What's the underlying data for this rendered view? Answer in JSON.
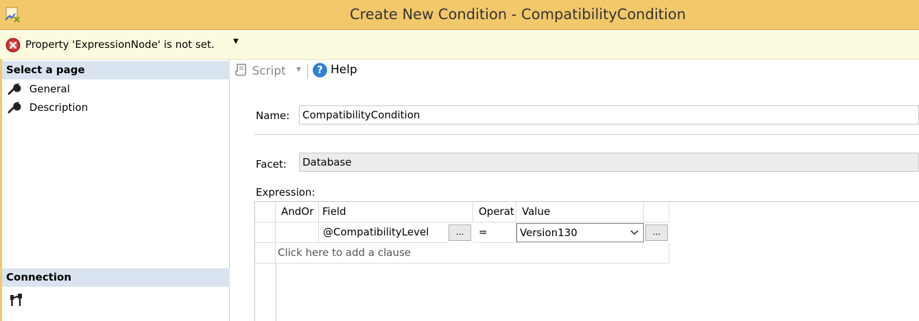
{
  "window": {
    "title": "Create New Condition - CompatibilityCondition",
    "app_icon": "policy-condition-icon"
  },
  "message_bar": {
    "icon": "error-icon",
    "text": "Property 'ExpressionNode' is not set."
  },
  "left_pane": {
    "select_page_header": "Select a page",
    "pages": [
      {
        "label": "General",
        "icon": "wrench-icon",
        "selected": true
      },
      {
        "label": "Description",
        "icon": "wrench-icon",
        "selected": false
      }
    ],
    "connection_header": "Connection",
    "connection_icon": "connection-icon"
  },
  "toolbar": {
    "script_label": "Script",
    "help_label": "Help"
  },
  "form": {
    "name_label": "Name:",
    "name_value": "CompatibilityCondition",
    "facet_label": "Facet:",
    "facet_value": "Database",
    "expression_label": "Expression:"
  },
  "expression_grid": {
    "columns": [
      "AndOr",
      "Field",
      "Operat",
      "Value"
    ],
    "rows": [
      {
        "andor": "",
        "field": "@CompatibilityLevel",
        "operator": "=",
        "value": "Version130"
      }
    ],
    "add_clause_text": "Click here to add a clause",
    "ellipsis": "..."
  }
}
